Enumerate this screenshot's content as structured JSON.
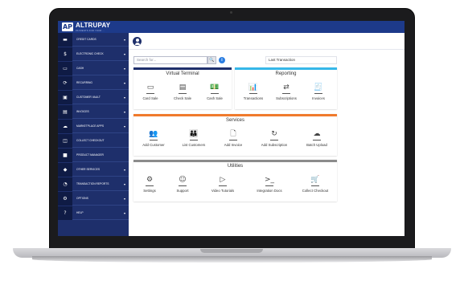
{
  "app": {
    "logo_mark": "AP",
    "logo_name": "ALTRUPAY",
    "logo_tagline": "PAYMENTS FOR YOUR ..."
  },
  "sidebar": {
    "items": [
      {
        "label": "Credit Cards",
        "icon": "card-icon",
        "glyph": "▬",
        "caret": "▾"
      },
      {
        "label": "Electronic Check",
        "icon": "dollar-icon",
        "glyph": "$",
        "caret": "▾"
      },
      {
        "label": "Cash",
        "icon": "cash-icon",
        "glyph": "▭",
        "caret": "▾"
      },
      {
        "label": "Recurring",
        "icon": "recurring-icon",
        "glyph": "⟳",
        "caret": "▾"
      },
      {
        "label": "Customer Vault",
        "icon": "vault-icon",
        "glyph": "▣",
        "caret": "▾"
      },
      {
        "label": "Invoices",
        "icon": "invoice-icon",
        "glyph": "▤",
        "caret": "▾"
      },
      {
        "label": "Marketplace Apps",
        "icon": "cloud-icon",
        "glyph": "☁",
        "caret": "▾"
      },
      {
        "label": "Collect Checkout",
        "icon": "basket-icon",
        "glyph": "◫",
        "caret": ""
      },
      {
        "label": "Product Manager",
        "icon": "box-icon",
        "glyph": "■",
        "caret": ""
      },
      {
        "label": "Other Services",
        "icon": "tag-icon",
        "glyph": "◆",
        "caret": "▾"
      },
      {
        "label": "Transaction Reports",
        "icon": "chart-icon",
        "glyph": "◔",
        "caret": "▾"
      },
      {
        "label": "Options",
        "icon": "options-icon",
        "glyph": "⚙",
        "caret": "▾"
      },
      {
        "label": "Help",
        "icon": "help-icon",
        "glyph": "?",
        "caret": "▾"
      }
    ]
  },
  "search": {
    "placeholder": "Search for...",
    "button_glyph": "🔍",
    "info_glyph": "i",
    "last_transaction_label": "Last Transaction"
  },
  "virtual_terminal": {
    "title": "Virtual Terminal",
    "color": "#1e2f6b",
    "tiles": [
      {
        "label": "Card Sale",
        "icon": "card-sale-icon",
        "glyph": "▭"
      },
      {
        "label": "Check Sale",
        "icon": "check-sale-icon",
        "glyph": "▤"
      },
      {
        "label": "Cash Sale",
        "icon": "cash-sale-icon",
        "glyph": "💵"
      }
    ]
  },
  "reporting": {
    "title": "Reporting",
    "color": "#35b7e8",
    "tiles": [
      {
        "label": "Transactions",
        "icon": "bar-chart-icon",
        "glyph": "📊"
      },
      {
        "label": "Subscriptions",
        "icon": "refresh-icon",
        "glyph": "⇄"
      },
      {
        "label": "Invoices",
        "icon": "invoice-doc-icon",
        "glyph": "🧾"
      }
    ]
  },
  "services": {
    "title": "Services",
    "color": "#f07a2c",
    "tiles": [
      {
        "label": "Add Customer",
        "icon": "add-customer-icon",
        "glyph": "👥"
      },
      {
        "label": "List Customers",
        "icon": "list-customers-icon",
        "glyph": "👪"
      },
      {
        "label": "Add Invoice",
        "icon": "add-invoice-icon",
        "glyph": "🗋"
      },
      {
        "label": "Add Subscription",
        "icon": "add-subscription-icon",
        "glyph": "↻"
      },
      {
        "label": "Batch Upload",
        "icon": "cloud-upload-icon",
        "glyph": "☁"
      }
    ]
  },
  "utilities": {
    "title": "Utilities",
    "color": "#8c8c8c",
    "tiles": [
      {
        "label": "Settings",
        "icon": "settings-icon",
        "glyph": "⚙"
      },
      {
        "label": "Support",
        "icon": "support-icon",
        "glyph": "☺"
      },
      {
        "label": "Video Tutorials",
        "icon": "video-icon",
        "glyph": "▷"
      },
      {
        "label": "Integration Docs",
        "icon": "terminal-icon",
        "glyph": ">_"
      },
      {
        "label": "Collect Checkout",
        "icon": "checkout-basket-icon",
        "glyph": "🛒"
      }
    ]
  }
}
